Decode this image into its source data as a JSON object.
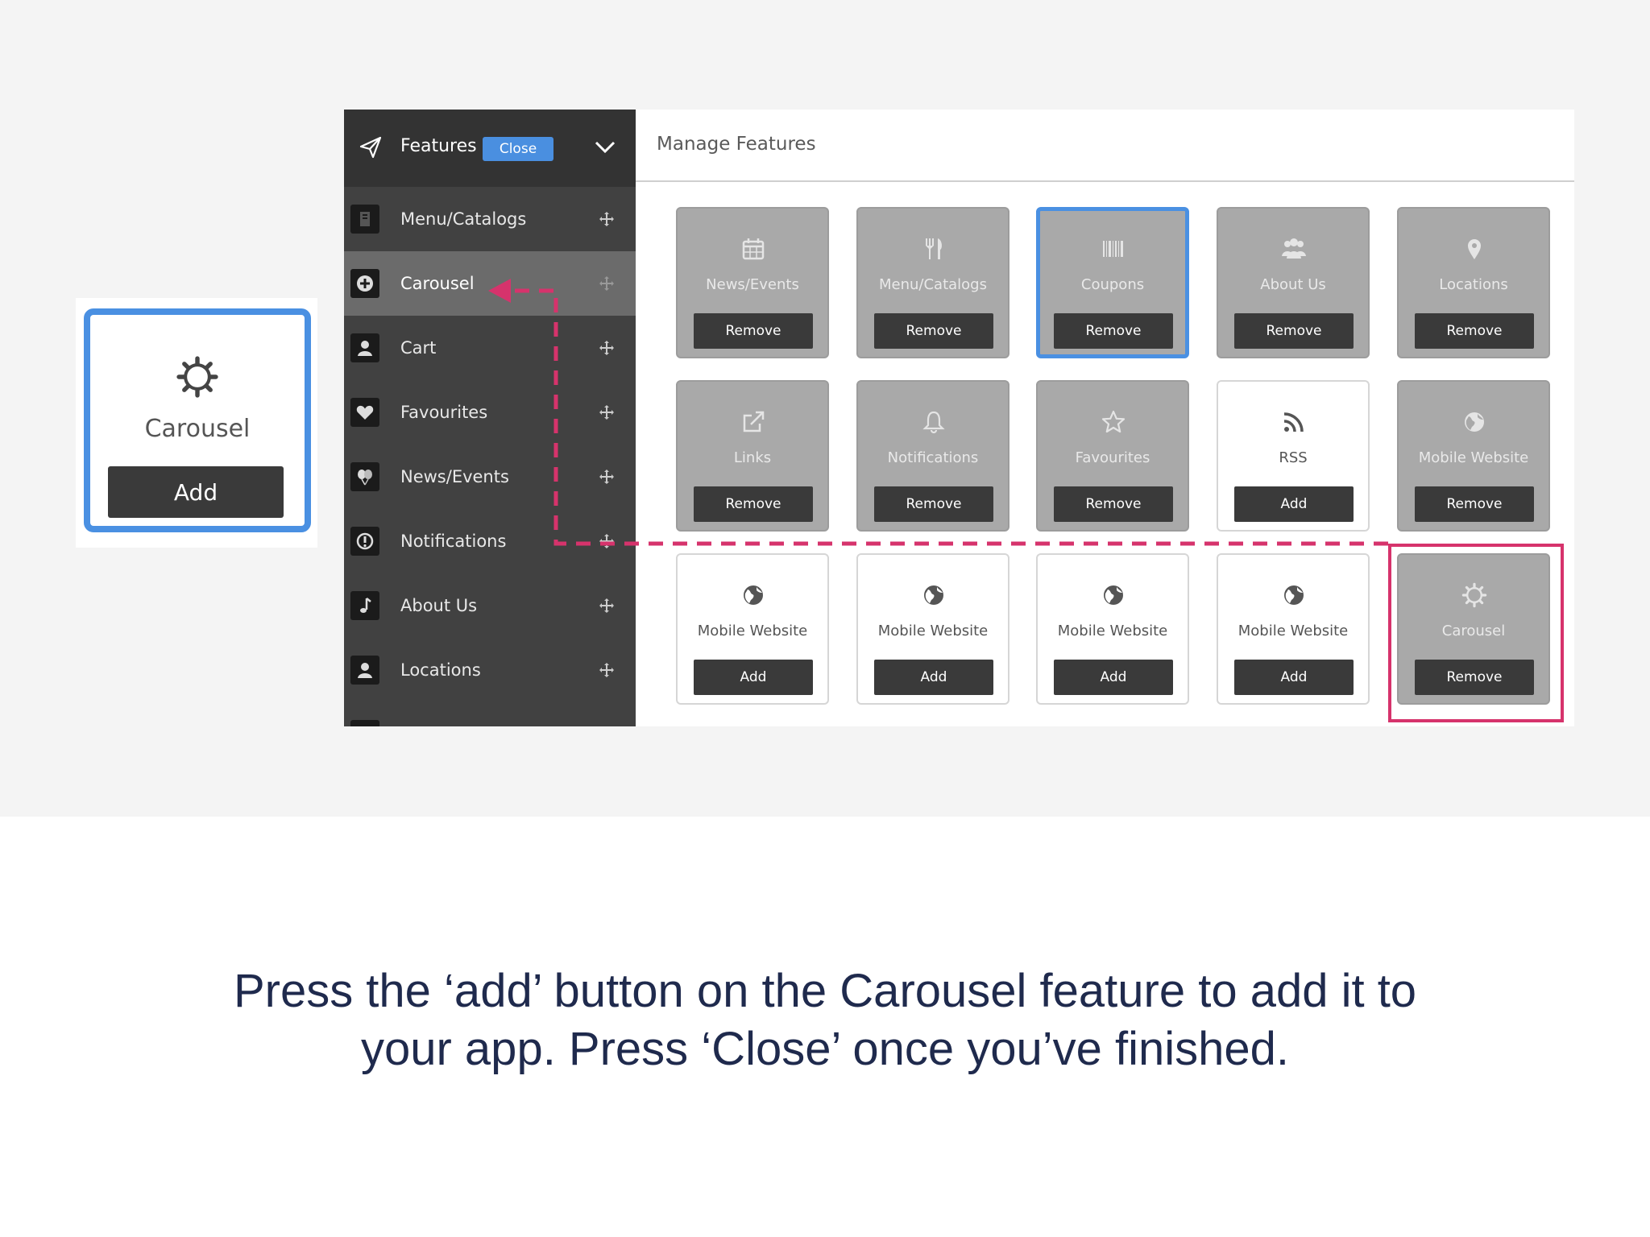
{
  "callout": {
    "label": "Carousel",
    "button": "Add"
  },
  "sidebar": {
    "title": "Features",
    "close_label": "Close",
    "items": [
      {
        "label": "Menu/Catalogs",
        "icon": "book-icon"
      },
      {
        "label": "Carousel",
        "icon": "plus-circle-icon",
        "active": true
      },
      {
        "label": "Cart",
        "icon": "person-icon"
      },
      {
        "label": "Favourites",
        "icon": "heart-icon"
      },
      {
        "label": "News/Events",
        "icon": "balloons-icon"
      },
      {
        "label": "Notifications",
        "icon": "alert-icon"
      },
      {
        "label": "About Us",
        "icon": "music-note-icon"
      },
      {
        "label": "Locations",
        "icon": "person-icon"
      }
    ]
  },
  "main": {
    "title": "Manage Features",
    "tiles": [
      {
        "label": "News/Events",
        "button": "Remove",
        "icon": "calendar-icon"
      },
      {
        "label": "Menu/Catalogs",
        "button": "Remove",
        "icon": "fork-knife-icon"
      },
      {
        "label": "Coupons",
        "button": "Remove",
        "icon": "barcode-icon"
      },
      {
        "label": "About Us",
        "button": "Remove",
        "icon": "group-icon"
      },
      {
        "label": "Locations",
        "button": "Remove",
        "icon": "map-pin-icon"
      },
      {
        "label": "Links",
        "button": "Remove",
        "icon": "external-link-icon"
      },
      {
        "label": "Notifications",
        "button": "Remove",
        "icon": "bell-icon"
      },
      {
        "label": "Favourites",
        "button": "Remove",
        "icon": "star-icon"
      },
      {
        "label": "RSS",
        "button": "Add",
        "icon": "rss-icon"
      },
      {
        "label": "Mobile Website",
        "button": "Remove",
        "icon": "globe-icon"
      },
      {
        "label": "Mobile Website",
        "button": "Add",
        "icon": "globe-icon"
      },
      {
        "label": "Mobile Website",
        "button": "Add",
        "icon": "globe-icon"
      },
      {
        "label": "Mobile Website",
        "button": "Add",
        "icon": "globe-icon"
      },
      {
        "label": "Mobile Website",
        "button": "Add",
        "icon": "globe-icon"
      },
      {
        "label": "Carousel",
        "button": "Remove",
        "icon": "gear-icon"
      }
    ]
  },
  "colors": {
    "accent_blue": "#4a90e2",
    "highlight_pink": "#d6336c",
    "sidebar_bg": "#414141",
    "tile_active_bg": "#a9a9a9",
    "button_dark": "#3a3a3a",
    "caption_navy": "#1f2a4d"
  },
  "instructions": {
    "line1": "Press the ‘add’ button on the Carousel feature to add it to",
    "line2": "your app. Press ‘Close’ once you’ve finished."
  }
}
